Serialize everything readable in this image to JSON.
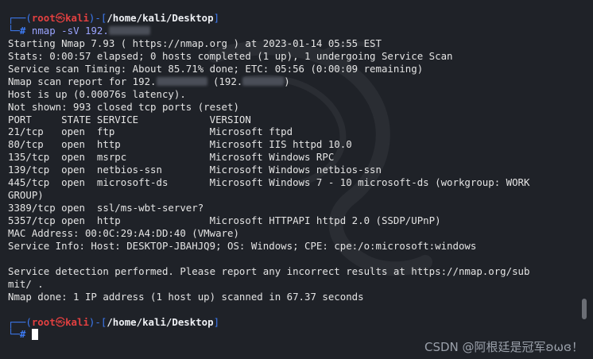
{
  "prompt": {
    "box_top": "┌──(",
    "user": "root",
    "at_symbol": "㉿",
    "host": "kali",
    "sep": ")-[",
    "path": "/home/kali/Desktop",
    "close": "]",
    "box_bottom": "└─",
    "hash": "#"
  },
  "command": {
    "program": "nmap",
    "args": "-sV 192."
  },
  "output": [
    "Starting Nmap 7.93 ( https://nmap.org ) at 2023-01-14 05:55 EST",
    "Stats: 0:00:57 elapsed; 0 hosts completed (1 up), 1 undergoing Service Scan",
    "Service scan Timing: About 85.71% done; ETC: 05:56 (0:00:09 remaining)"
  ],
  "report": {
    "prefix": "Nmap scan report for 192.",
    "middle": " (192.",
    "suffix": ")"
  },
  "output2": [
    "Host is up (0.00076s latency).",
    "Not shown: 993 closed tcp ports (reset)",
    "PORT     STATE SERVICE            VERSION",
    "21/tcp   open  ftp                Microsoft ftpd",
    "80/tcp   open  http               Microsoft IIS httpd 10.0",
    "135/tcp  open  msrpc              Microsoft Windows RPC",
    "139/tcp  open  netbios-ssn        Microsoft Windows netbios-ssn",
    "445/tcp  open  microsoft-ds       Microsoft Windows 7 - 10 microsoft-ds (workgroup: WORK",
    "GROUP)",
    "3389/tcp open  ssl/ms-wbt-server?",
    "5357/tcp open  http               Microsoft HTTPAPI httpd 2.0 (SSDP/UPnP)",
    "MAC Address: 00:0C:29:A4:DD:40 (VMware)",
    "Service Info: Host: DESKTOP-JBAHJQ9; OS: Windows; CPE: cpe:/o:microsoft:windows",
    "",
    "Service detection performed. Please report any incorrect results at https://nmap.org/sub",
    "mit/ .",
    "Nmap done: 1 IP address (1 host up) scanned in 67.37 seconds"
  ],
  "watermark": "CSDN @阿根廷是冠军ʚωɞ！",
  "colors": {
    "background": "#1f2228",
    "prompt_box": "#3d7bf4",
    "prompt_user": "#e34040",
    "command": "#9aa4ff",
    "text": "#e4e4e4"
  }
}
